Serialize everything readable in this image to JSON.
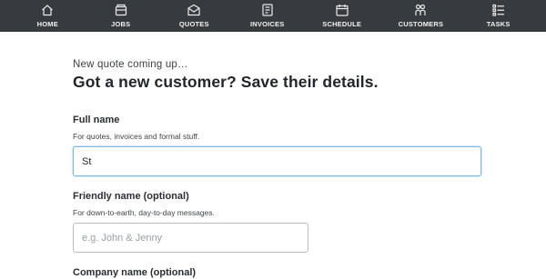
{
  "nav": {
    "items": [
      {
        "label": "HOME",
        "icon": "home-icon"
      },
      {
        "label": "JOBS",
        "icon": "jobs-icon"
      },
      {
        "label": "QUOTES",
        "icon": "quotes-icon"
      },
      {
        "label": "INVOICES",
        "icon": "invoices-icon"
      },
      {
        "label": "SCHEDULE",
        "icon": "calendar-icon"
      },
      {
        "label": "CUSTOMERS",
        "icon": "customers-icon"
      },
      {
        "label": "TASKS",
        "icon": "tasks-icon"
      }
    ]
  },
  "form": {
    "kicker": "New quote coming up…",
    "title": "Got a new customer? Save their details.",
    "full_name": {
      "label": "Full name",
      "hint": "For quotes, invoices and formal stuff.",
      "value": "St"
    },
    "friendly_name": {
      "label": "Friendly name (optional)",
      "hint": "For down-to-earth, day-to-day messages.",
      "placeholder": "e.g. John & Jenny"
    },
    "company_name": {
      "label": "Company name (optional)"
    }
  },
  "colors": {
    "nav_bg": "#383b3e",
    "focus_border": "#7fb8de"
  }
}
